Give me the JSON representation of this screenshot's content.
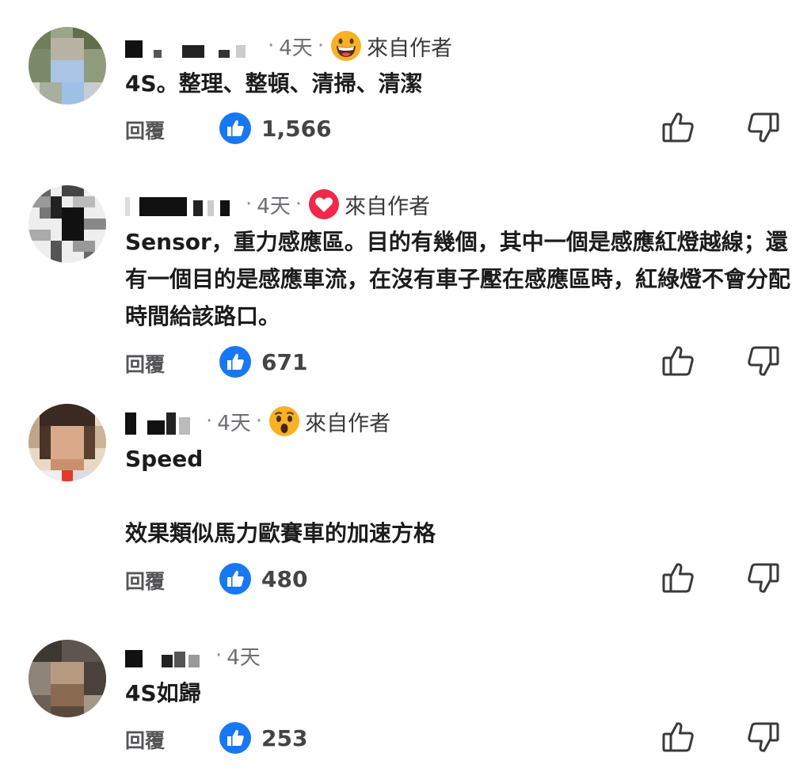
{
  "labels": {
    "reply": "回覆",
    "author_tag": "來自作者",
    "separator": "·"
  },
  "colors": {
    "like_blue": "#1877f2",
    "heart_red": "#f0284a",
    "reaction_yellow": "#f7b125"
  },
  "comments": [
    {
      "time": "4天",
      "reaction_icon": "grinning-face-icon",
      "author_tag": true,
      "body": "4S。整理、整頓、清掃、清潔",
      "likes": "1,566"
    },
    {
      "time": "4天",
      "reaction_icon": "heart-icon",
      "author_tag": true,
      "body": "Sensor，重力感應區。目的有幾個，其中一個是感應紅燈越線；還有一個目的是感應車流，在沒有車子壓在感應區時，紅綠燈不會分配時間給該路口。",
      "likes": "671"
    },
    {
      "time": "4天",
      "reaction_icon": "surprised-face-icon",
      "author_tag": true,
      "body": "Speed\n\n效果類似馬力歐賽車的加速方格",
      "likes": "480"
    },
    {
      "time": "4天",
      "reaction_icon": "",
      "author_tag": false,
      "body": "4S如歸",
      "likes": "253"
    }
  ]
}
